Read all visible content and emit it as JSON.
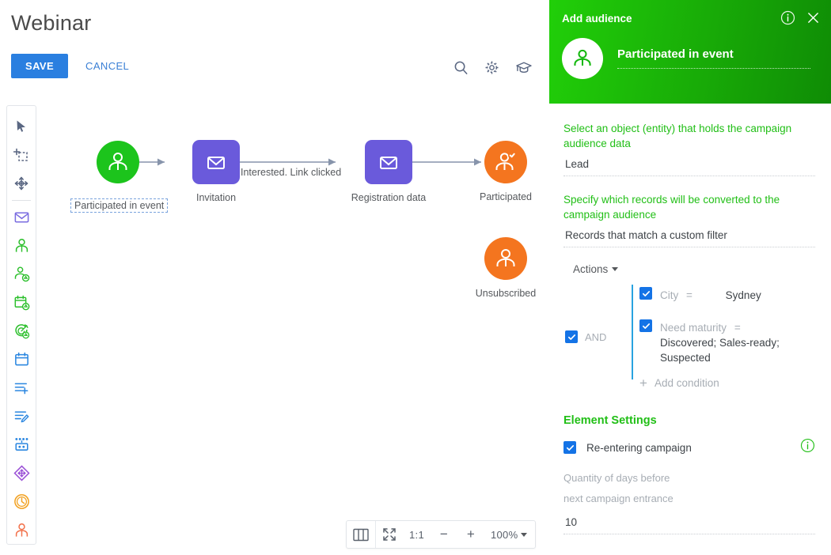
{
  "header": {
    "title": "Webinar",
    "save_label": "SAVE",
    "cancel_label": "CANCEL",
    "icons": [
      "search-icon",
      "gear-icon",
      "graduation-cap-icon"
    ]
  },
  "tool_sidebar": {
    "items": [
      {
        "name": "pointer-tool",
        "color": "#5a6782"
      },
      {
        "name": "add-selection-tool",
        "color": "#5a6782"
      },
      {
        "name": "pan-move-tool",
        "color": "#5a6782"
      },
      {
        "name": "email-element",
        "color": "#7a6ce0"
      },
      {
        "name": "audience-element",
        "color": "#2bbf2b"
      },
      {
        "name": "audience-condition-element",
        "color": "#2bbf2b"
      },
      {
        "name": "scheduled-event-element",
        "color": "#2bbf2b"
      },
      {
        "name": "goal-element",
        "color": "#2bbf2b"
      },
      {
        "name": "calendar-element",
        "color": "#2a86e0"
      },
      {
        "name": "add-record-element",
        "color": "#2a86e0"
      },
      {
        "name": "edit-record-element",
        "color": "#2a86e0"
      },
      {
        "name": "process-element",
        "color": "#2a86e0"
      },
      {
        "name": "switch-element",
        "color": "#9a4fd6"
      },
      {
        "name": "timer-element",
        "color": "#f2a01e"
      },
      {
        "name": "exit-element",
        "color": "#f2714a"
      }
    ]
  },
  "canvas": {
    "nodes": [
      {
        "id": "participated-in-event",
        "label": "Participated in event",
        "shape": "circle",
        "color": "#1cc41c",
        "icon": "audience-icon",
        "selected": true
      },
      {
        "id": "invitation",
        "label": "Invitation",
        "shape": "rect",
        "color": "#6a5adb",
        "icon": "email-icon",
        "selected": false
      },
      {
        "id": "registration-data",
        "label": "Registration data",
        "shape": "rect",
        "color": "#6a5adb",
        "icon": "email-icon",
        "selected": false
      },
      {
        "id": "participated",
        "label": "Participated",
        "shape": "circle",
        "color": "#f4751f",
        "icon": "audience-check-icon",
        "selected": false
      },
      {
        "id": "unsubscribed",
        "label": "Unsubscribed",
        "shape": "circle",
        "color": "#f4751f",
        "icon": "audience-icon",
        "selected": false
      }
    ],
    "edge_labels": [
      {
        "id": "edge-invitation-registration",
        "text": "Interested. Link clicked"
      }
    ]
  },
  "zoombar": {
    "columns_label": "columns-icon",
    "fit_label": "fit-screen-icon",
    "ratio_label": "1:1",
    "minus_label": "−",
    "plus_label": "+",
    "zoom_level": "100%"
  },
  "panel": {
    "header_title": "Add audience",
    "element_name": "Participated in event",
    "info_icon": "info-icon",
    "close_icon": "close-icon",
    "avatar_icon": "audience-icon",
    "fields": [
      {
        "label": "Select an object (entity) that holds the campaign audience data",
        "value": "Lead"
      },
      {
        "label": "Specify which records will be converted to the campaign audience",
        "value": "Records that match a custom filter"
      }
    ],
    "filter": {
      "actions_label": "Actions",
      "logic_operator": "AND",
      "conditions": [
        {
          "field": "City",
          "operator": "=",
          "value": "Sydney"
        },
        {
          "field": "Need maturity",
          "operator": "=",
          "value": "Discovered; Sales-ready; Suspected"
        }
      ],
      "add_condition_label": "Add condition"
    },
    "settings": {
      "section_title": "Element Settings",
      "reentering_label": "Re-entering campaign",
      "days_hint_line1": "Quantity of days before",
      "days_hint_line2": "next campaign entrance",
      "days_value": "10"
    }
  },
  "colors": {
    "brand_green": "#21bf16",
    "accent_blue": "#1473e6",
    "purple": "#6a5adb",
    "orange": "#f4751f",
    "green_node": "#1cc41c"
  }
}
